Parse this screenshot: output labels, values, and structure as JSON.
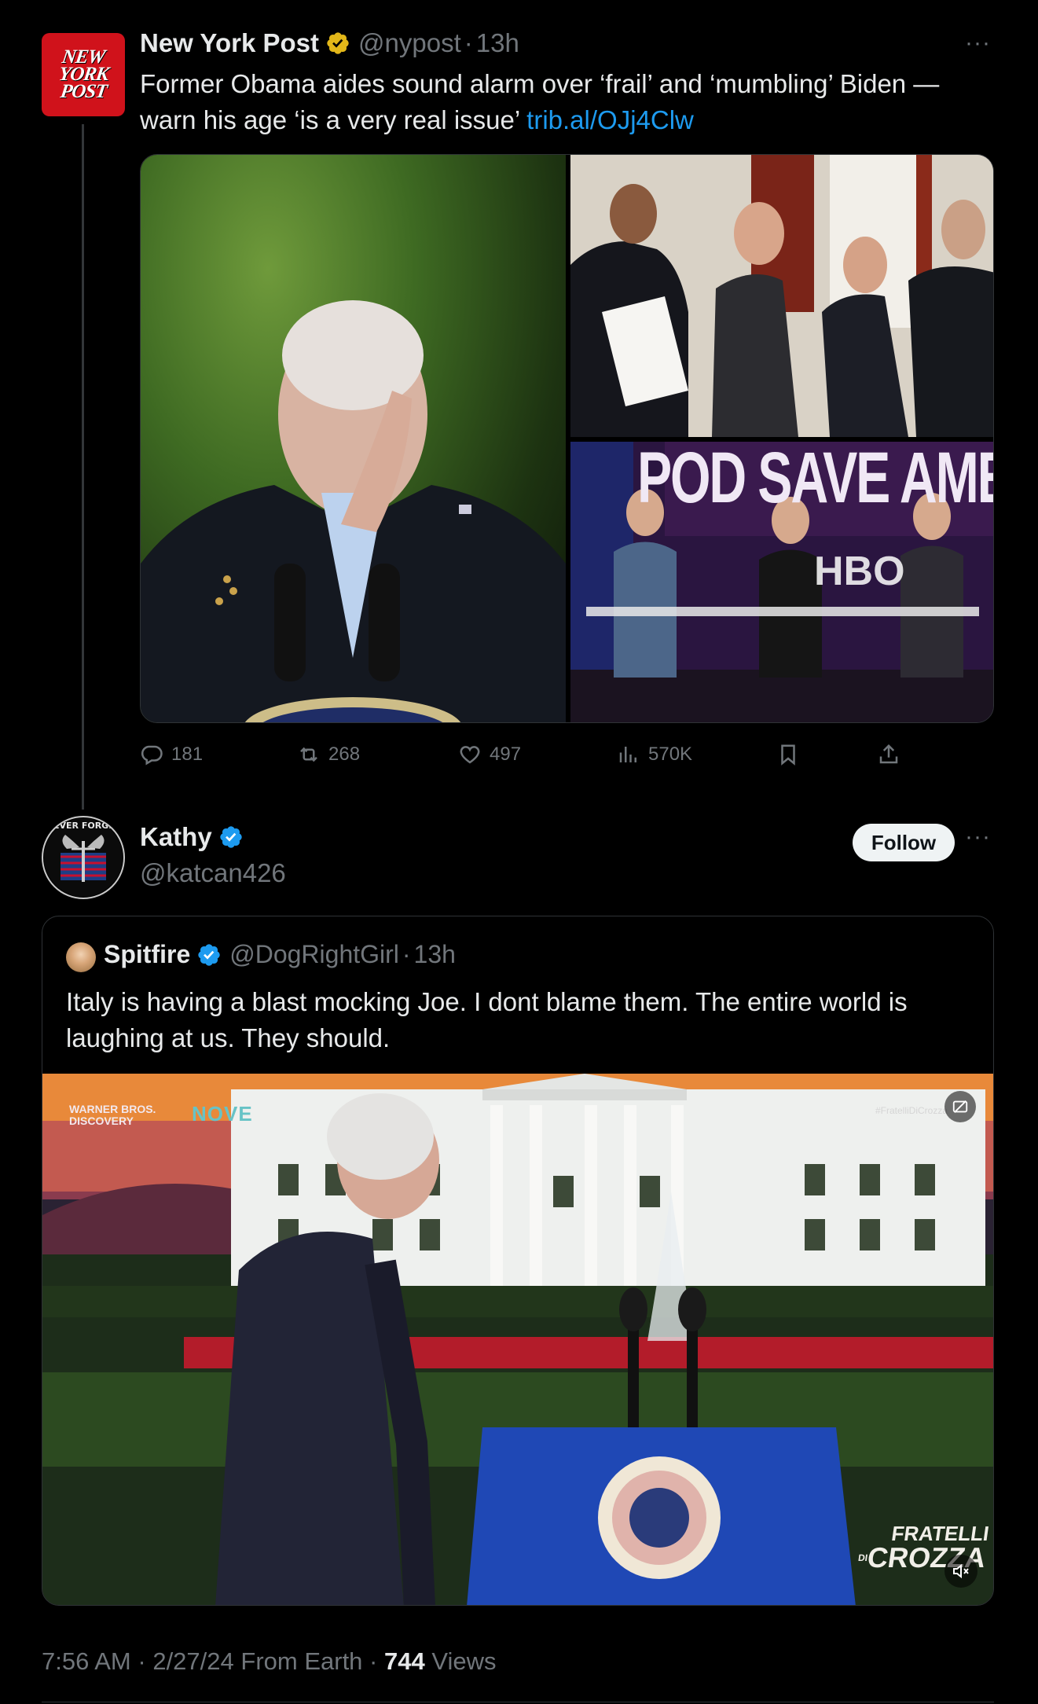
{
  "tweet1": {
    "avatar_text": [
      "NEW",
      "YORK",
      "POST"
    ],
    "name": "New York Post",
    "handle": "@nypost",
    "separator": "·",
    "time": "13h",
    "more": "···",
    "text_line1": "Former Obama aides sound alarm over ‘frail’ and ‘mumbling’ Biden —",
    "text_line2": "warn his age ‘is a very real issue’ ",
    "link": "trib.al/OJj4Clw",
    "media": {
      "pod_sign": "POD SAVE AMEI",
      "hbo": "HBO"
    },
    "actions": {
      "replies": "181",
      "reposts": "268",
      "likes": "497",
      "views": "570K"
    },
    "colors": {
      "verified_badge": "#e2b719",
      "link": "#1d9bf0"
    }
  },
  "tweet2": {
    "name": "Kathy",
    "handle": "@katcan426",
    "follow_label": "Follow",
    "more": "···",
    "avatar_text": "NEVER FORGET",
    "quote": {
      "name": "Spitfire",
      "handle": "@DogRightGirl",
      "separator": "·",
      "time": "13h",
      "text_line1": "Italy is having a blast mocking Joe. I dont blame them. The entire world is",
      "text_line2": "laughing at us. They should.",
      "video": {
        "watermark": "WARNER BROS. DISCOVERY",
        "channel": "NOVE",
        "hashtag": "#FratelliDiCrozza",
        "show_title_1": "FRATELLI",
        "show_title_2": "CROZZA",
        "show_title_di": "DI"
      }
    },
    "footer": {
      "time": "7:56 AM",
      "date": "2/27/24",
      "source": "From Earth",
      "views_count": "744",
      "views_label": "Views",
      "separator": "·"
    },
    "colors": {
      "verified_badge": "#1d9bf0"
    }
  }
}
